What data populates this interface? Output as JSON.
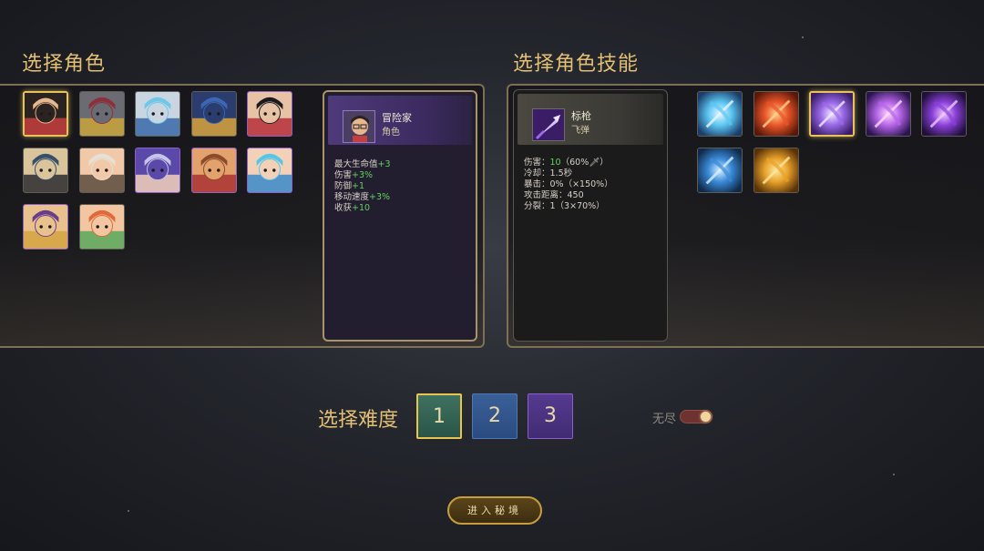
{
  "character_section": {
    "title": "选择角色",
    "roster": [
      {
        "name": "冒险家",
        "colors": [
          "#e7b78f",
          "#2b2320",
          "#c63f3f"
        ],
        "selected": true
      },
      {
        "name": "character-2",
        "colors": [
          "#8c2f3a",
          "#6b6b74",
          "#c9a43c"
        ]
      },
      {
        "name": "character-3",
        "colors": [
          "#6fc6e8",
          "#c9d6e2",
          "#3a6aa8"
        ]
      },
      {
        "name": "character-4",
        "colors": [
          "#3c67b5",
          "#2a3d6e",
          "#d8a23a"
        ]
      },
      {
        "name": "character-5",
        "colors": [
          "#1d1a1f",
          "#e7c2a5",
          "#b62f38"
        ],
        "purple": true
      },
      {
        "name": "character-6",
        "colors": [
          "#36506b",
          "#d9c49b",
          "#2b2b30"
        ]
      },
      {
        "name": "character-7",
        "colors": [
          "#e6e1d6",
          "#f1c9a8",
          "#5a4b3c"
        ]
      },
      {
        "name": "character-8",
        "colors": [
          "#c6c5e8",
          "#5a49a8",
          "#f2d0b8"
        ],
        "purple": true
      },
      {
        "name": "character-9",
        "colors": [
          "#8a4a2c",
          "#e3a26b",
          "#a83232"
        ],
        "purple": true
      },
      {
        "name": "character-10",
        "colors": [
          "#52c7e8",
          "#f2d1b8",
          "#3a8ac8"
        ],
        "purple": true
      },
      {
        "name": "character-11",
        "colors": [
          "#6a3d8c",
          "#e8c18c",
          "#d4a441"
        ],
        "purple": true
      },
      {
        "name": "character-12",
        "colors": [
          "#e0683a",
          "#f2c6a0",
          "#58a85c"
        ]
      }
    ],
    "detail": {
      "name": "冒险家",
      "type": "角色",
      "stats": [
        {
          "label": "最大生命值",
          "value": "+3"
        },
        {
          "label": "伤害",
          "value": "+3%"
        },
        {
          "label": "防御",
          "value": "+1"
        },
        {
          "label": "移动速度",
          "value": "+3%"
        },
        {
          "label": "收获",
          "value": "+10"
        }
      ]
    }
  },
  "skill_section": {
    "title": "选择角色技能",
    "skills": [
      {
        "name": "ice-shard",
        "colors": [
          "#1a3d6a",
          "#5cc6f2",
          "#e8f6ff"
        ]
      },
      {
        "name": "fireball",
        "colors": [
          "#5a1808",
          "#e8552a",
          "#ffd089"
        ]
      },
      {
        "name": "标枪",
        "colors": [
          "#3a1d66",
          "#9a6ae8",
          "#f2e6ff"
        ],
        "selected": true
      },
      {
        "name": "void-orb",
        "colors": [
          "#2b1450",
          "#b565e8",
          "#ffd6f8"
        ]
      },
      {
        "name": "shadow-slash",
        "colors": [
          "#1f0f3a",
          "#8a40d8",
          "#f0c8ff"
        ]
      },
      {
        "name": "lightning",
        "colors": [
          "#0f2a4a",
          "#3a8ad8",
          "#d8f0ff"
        ]
      },
      {
        "name": "golden-palm",
        "colors": [
          "#5a3208",
          "#e8a22a",
          "#ffe8a0"
        ]
      }
    ],
    "detail": {
      "name": "标枪",
      "type": "飞弹",
      "stats": [
        {
          "label": "伤害：",
          "value": "10",
          "suffix": "（60%🗡）"
        },
        {
          "label": "冷却：",
          "value": "1.5秒"
        },
        {
          "label": "暴击：",
          "value": "0%（×150%）"
        },
        {
          "label": "攻击距离：",
          "value": "450"
        },
        {
          "label": "分裂：",
          "value": "1（3×70%）"
        }
      ]
    }
  },
  "difficulty": {
    "label": "选择难度",
    "options": [
      "1",
      "2",
      "3"
    ],
    "selected": "1"
  },
  "endless": {
    "label": "无尽",
    "enabled": true
  },
  "enter_button": {
    "label": "进入秘境"
  }
}
